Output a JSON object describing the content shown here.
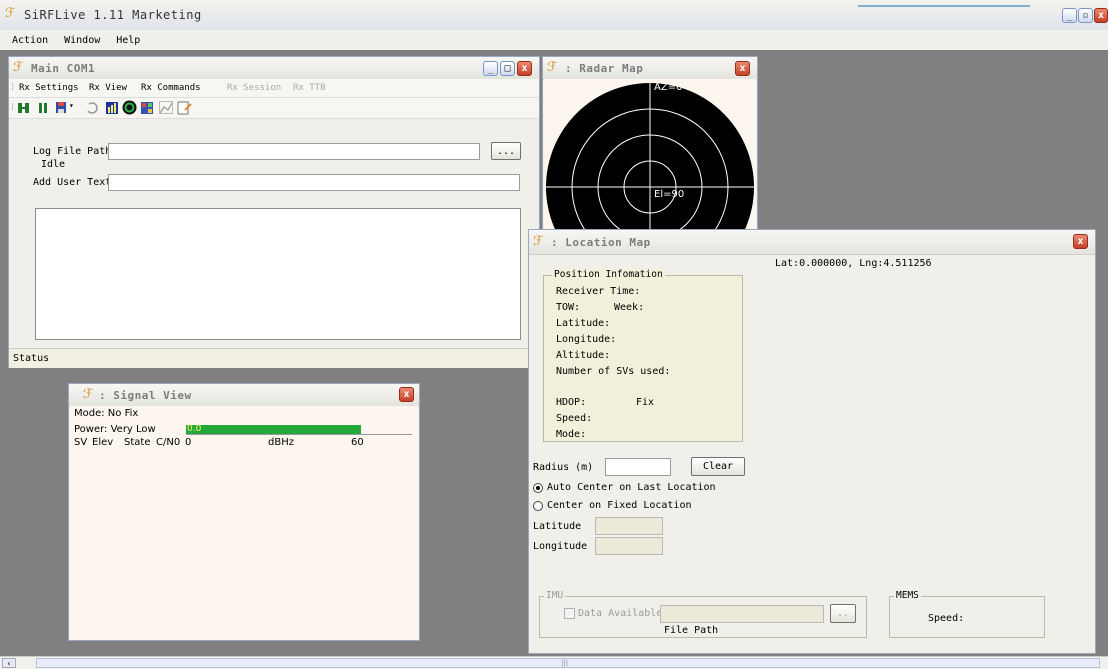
{
  "app": {
    "title": "SiRFLive 1.11 Marketing",
    "menu": [
      "Action",
      "Window",
      "Help"
    ]
  },
  "main_com": {
    "title": "Main COM1",
    "menu": [
      "Rx Settings",
      "Rx View",
      "Rx Commands",
      "Rx Session",
      "Rx TTB"
    ],
    "log_file_label": "Log File Path:",
    "log_file_status": "Idle",
    "browse_label": "...",
    "user_text_label": "Add User Text:",
    "status_label": "Status"
  },
  "radar": {
    "title": ": Radar Map",
    "az_label": "AZ=0",
    "el_label": "El=90"
  },
  "signal": {
    "title": ": Signal View",
    "mode_line": "Mode: No Fix",
    "power_line": "Power: Very Low",
    "power_value": "0.0",
    "power_fraction": 0.0,
    "header_cols": [
      "SV",
      "Elev",
      "State",
      "C/N0"
    ],
    "scale_min": "0",
    "scale_unit": "dBHz",
    "scale_max": "60"
  },
  "location": {
    "title": ": Location Map",
    "latlng": "Lat:0.000000, Lng:4.511256",
    "position_group": "Position Infomation",
    "receiver_time": "Receiver Time:",
    "tow": "TOW:",
    "week": "Week:",
    "latitude": "Latitude:",
    "longitude": "Longitude:",
    "altitude": "Altitude:",
    "num_svs": "Number of SVs used:",
    "hdop": "HDOP:",
    "fix": "Fix",
    "speed": "Speed:",
    "mode": "Mode:",
    "radius_label": "Radius (m)",
    "clear_label": "Clear",
    "radio_auto": "Auto Center on Last Location",
    "radio_fixed": "Center on Fixed Location",
    "fixed_lat_label": "Latitude",
    "fixed_lng_label": "Longitude",
    "imu_group": "IMU",
    "data_available": "Data Available",
    "file_path": "File Path",
    "imu_browse": "..",
    "mems_group": "MEMS",
    "mems_speed": "Speed:"
  },
  "scrollbar": {
    "thumb_glyph": "|||"
  },
  "colors": {
    "power_bar": "#22a83a",
    "radar_bg": "#000000",
    "note_bg": "#f2f0da"
  }
}
